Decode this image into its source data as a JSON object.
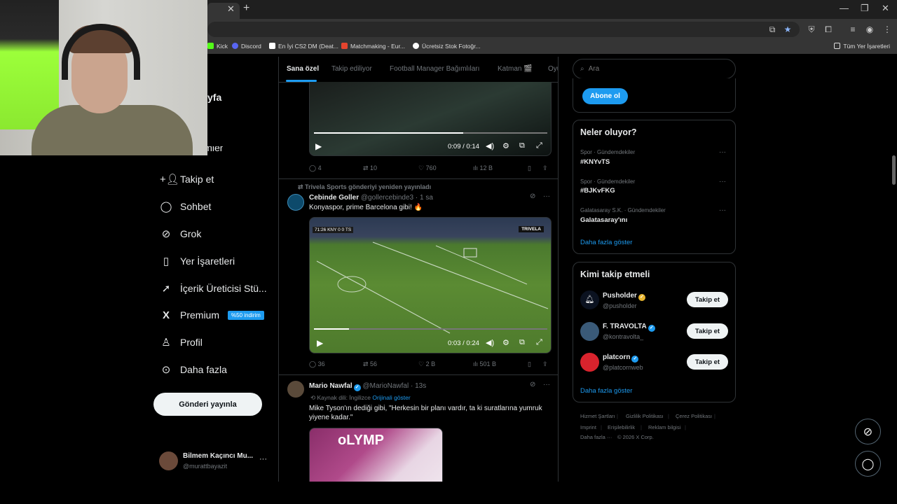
{
  "browser": {
    "tab_close": "✕",
    "new_tab": "+",
    "window_controls": [
      "—",
      "❐",
      "✕"
    ],
    "bookmarks": [
      {
        "label": "Kick",
        "color": "#53fc18"
      },
      {
        "label": "Discord",
        "color": "#5865f2"
      },
      {
        "label": "En İyi CS2 DM (Deat...",
        "color": "#ffffff"
      },
      {
        "label": "Matchmaking - Eur...",
        "color": "#e5442e"
      },
      {
        "label": "Ücretsiz Stok Fotoğr...",
        "color": "#ffffff"
      }
    ],
    "all_bookmarks": "Tüm Yer İşaretleri"
  },
  "sidebar": {
    "partial_item": "yfa",
    "partial_item2": "Bildirimler",
    "items": [
      {
        "label": "Takip et",
        "icon": "add-user-icon",
        "glyph": "👤"
      },
      {
        "label": "Sohbet",
        "icon": "chat-icon",
        "glyph": "💬"
      },
      {
        "label": "Grok",
        "icon": "grok-icon",
        "glyph": "⊘"
      },
      {
        "label": "Yer İşaretleri",
        "icon": "bookmark-icon",
        "glyph": "🔖"
      },
      {
        "label": "İçerik Üreticisi Stü...",
        "icon": "rocket-icon",
        "glyph": "🚀"
      },
      {
        "label": "Premium",
        "icon": "x-logo-icon",
        "glyph": "𝕏"
      },
      {
        "label": "Profil",
        "icon": "profile-icon",
        "glyph": "👤"
      },
      {
        "label": "Daha fazla",
        "icon": "more-icon",
        "glyph": "⋯"
      }
    ],
    "premium_badge": "%50 indirim",
    "post_button": "Gönderi yayınla",
    "account": {
      "name": "Bilmem Kaçıncı Mu...",
      "handle": "@murattbayazit",
      "more": "···"
    }
  },
  "timeline": {
    "tabs": [
      "Sana özel",
      "Takip ediliyor",
      "Football Manager Bağımlıları",
      "Katman 🎬",
      "Oyu"
    ],
    "post1": {
      "video_time": "0:09 / 0:14",
      "video_progress": 0.64,
      "replies": "4",
      "reposts": "10",
      "likes": "760",
      "views": "12 B"
    },
    "post2": {
      "repost_note": "Trivela Sports gönderiyi yeniden yayınladı",
      "name": "Cebinde Goller",
      "handle": "@gollercebinde3",
      "time": "· 1 sa",
      "text": "Konyaspor, prime Barcelona gibi! 🔥",
      "scoreboard": "71:26  KNY 0 0 TS",
      "brand": "TRIVELA",
      "video_time": "0:03 / 0:24",
      "video_progress": 0.15,
      "replies": "36",
      "reposts": "56",
      "likes": "2 B",
      "views": "501 B"
    },
    "post3": {
      "name": "Mario Nawfal",
      "handle": "@MarioNawfal",
      "time": "· 13s",
      "translate_note": "Kaynak dili: İngilizce",
      "translate_link": "Orijinali göster",
      "text": "Mike Tyson'ın dediği gibi, \"Herkesin bir planı vardır, ta ki suratlarına yumruk yiyene kadar.\"",
      "image_text": "oLYMP"
    }
  },
  "right": {
    "search_placeholder": "Ara",
    "subscribe": "Abone ol",
    "trends_title": "Neler oluyor?",
    "trends": [
      {
        "category": "Spor · Gündemdekiler",
        "name": "#KNYvTS"
      },
      {
        "category": "Spor · Gündemdekiler",
        "name": "#BJKvFKG"
      },
      {
        "category": "Galatasaray S.K. · Gündemdekiler",
        "name": "Galatasaray'ını"
      }
    ],
    "trends_more": "Daha fazla göster",
    "who_title": "Kimi takip etmeli",
    "who": [
      {
        "name": "Pusholder",
        "handle": "@pusholder",
        "badge": "gold",
        "color": "#0b1220"
      },
      {
        "name": "F. TRAVOLTA",
        "handle": "@kontravolta_",
        "badge": "blue",
        "color": "#3a5a78"
      },
      {
        "name": "platcorn",
        "handle": "@platcornweb",
        "badge": "blue",
        "color": "#d9232d"
      }
    ],
    "follow_label": "Takip et",
    "who_more": "Daha fazla göster",
    "footer": [
      "Hizmet Şartları",
      "Gizlilik Politikası",
      "Çerez Politikası",
      "Imprint",
      "Erişilebilirlik",
      "Reklam bilgisi",
      "Daha fazla ···",
      "© 2026 X Corp."
    ]
  }
}
